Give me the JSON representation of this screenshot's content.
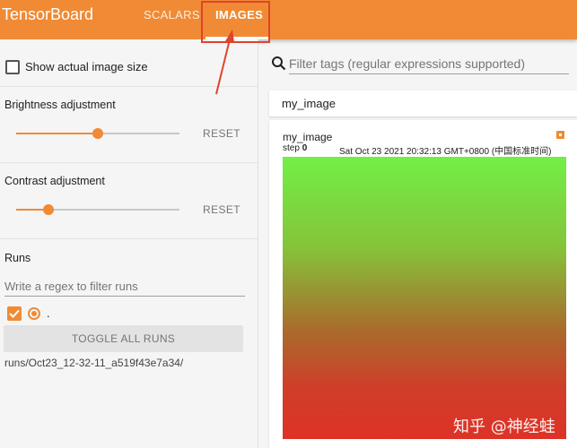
{
  "header": {
    "brand": "TensorBoard",
    "tabs": [
      {
        "label": "SCALARS",
        "active": false
      },
      {
        "label": "IMAGES",
        "active": true
      }
    ],
    "accent_color": "#f08a34"
  },
  "sidebar": {
    "show_actual_size_label": "Show actual image size",
    "show_actual_size_checked": false,
    "brightness": {
      "label": "Brightness adjustment",
      "reset_label": "RESET",
      "value": 0.5
    },
    "contrast": {
      "label": "Contrast adjustment",
      "reset_label": "RESET",
      "value": 0.2
    },
    "runs": {
      "heading": "Runs",
      "filter_placeholder": "Write a regex to filter runs",
      "items": [
        {
          "label": ".",
          "checked": true
        }
      ],
      "toggle_all_label": "TOGGLE ALL RUNS",
      "run_path": "runs/Oct23_12-32-11_a519f43e7a34/"
    }
  },
  "main": {
    "filter_placeholder": "Filter tags (regular expressions supported)",
    "tag_group": {
      "title": "my_image",
      "card": {
        "title": "my_image",
        "step_label": "step",
        "step_value": "0",
        "timestamp": "Sat Oct 23 2021 20:32:13 GMT+0800 (中国标准时间)"
      }
    }
  },
  "watermark": "知乎 @神经蛙",
  "icons": [
    "search-icon",
    "checkbox-icon",
    "radio-icon",
    "expand-icon",
    "check-icon"
  ],
  "annotation_color": "#e0432c"
}
